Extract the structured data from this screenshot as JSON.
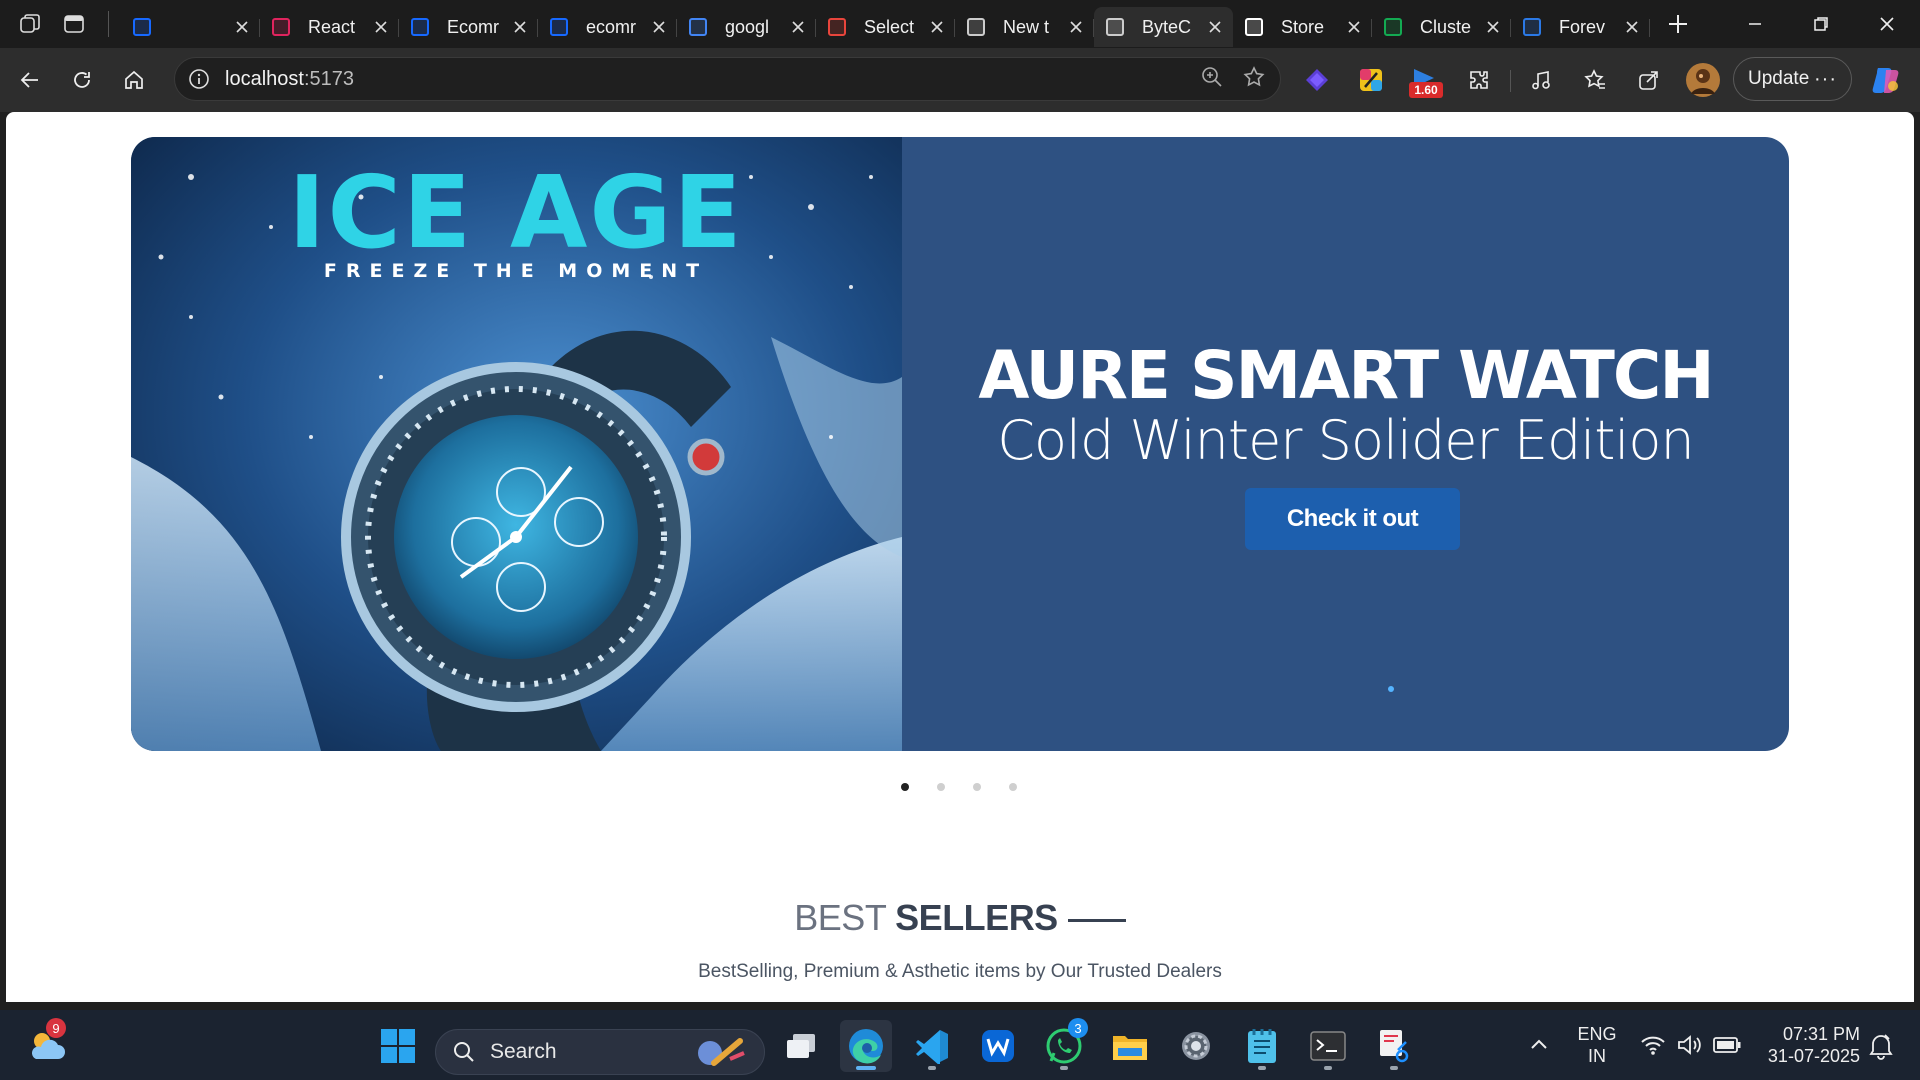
{
  "browser": {
    "tabs": [
      {
        "title": "",
        "favicon": "behance-icon",
        "color": "#1769ff"
      },
      {
        "title": "React",
        "favicon": "react-icon",
        "color": "#e0245e"
      },
      {
        "title": "Ecomr",
        "favicon": "behance-icon",
        "color": "#1769ff"
      },
      {
        "title": "ecomr",
        "favicon": "behance-icon",
        "color": "#1769ff"
      },
      {
        "title": "googl",
        "favicon": "search-icon",
        "color": "#4285f4"
      },
      {
        "title": "Select",
        "favicon": "gradient-icon",
        "color": "#e8453c"
      },
      {
        "title": "New t",
        "favicon": "new-tab-icon",
        "color": "#cccccc"
      },
      {
        "title": "ByteC",
        "favicon": "cart-icon",
        "color": "#cccccc",
        "active": true
      },
      {
        "title": "Store",
        "favicon": "openai-icon",
        "color": "#ffffff"
      },
      {
        "title": "Cluste",
        "favicon": "mongodb-leaf-icon",
        "color": "#13aa52"
      },
      {
        "title": "Forev",
        "favicon": "shop-icon",
        "color": "#2b79e6"
      }
    ],
    "address": {
      "host": "localhost",
      "port": ":5173"
    },
    "update_label": "Update",
    "extension_badge": "1.60"
  },
  "hero": {
    "image_title": "ICE AGE",
    "image_tagline": "FREEZE THE MOMENT",
    "title": "AURE SMART WATCH",
    "subtitle": "Cold Winter Solider Edition",
    "cta": "Check it out",
    "slide_count": 4,
    "active_slide": 1
  },
  "section": {
    "title_light": "BEST",
    "title_bold": "SELLERS",
    "subtitle": "BestSelling, Premium & Asthetic items by Our Trusted Dealers"
  },
  "taskbar": {
    "search_label": "Search",
    "weather_badge": "9",
    "whatsapp_badge": "3",
    "lang_line1": "ENG",
    "lang_line2": "IN",
    "time": "07:31 PM",
    "date": "31-07-2025"
  }
}
